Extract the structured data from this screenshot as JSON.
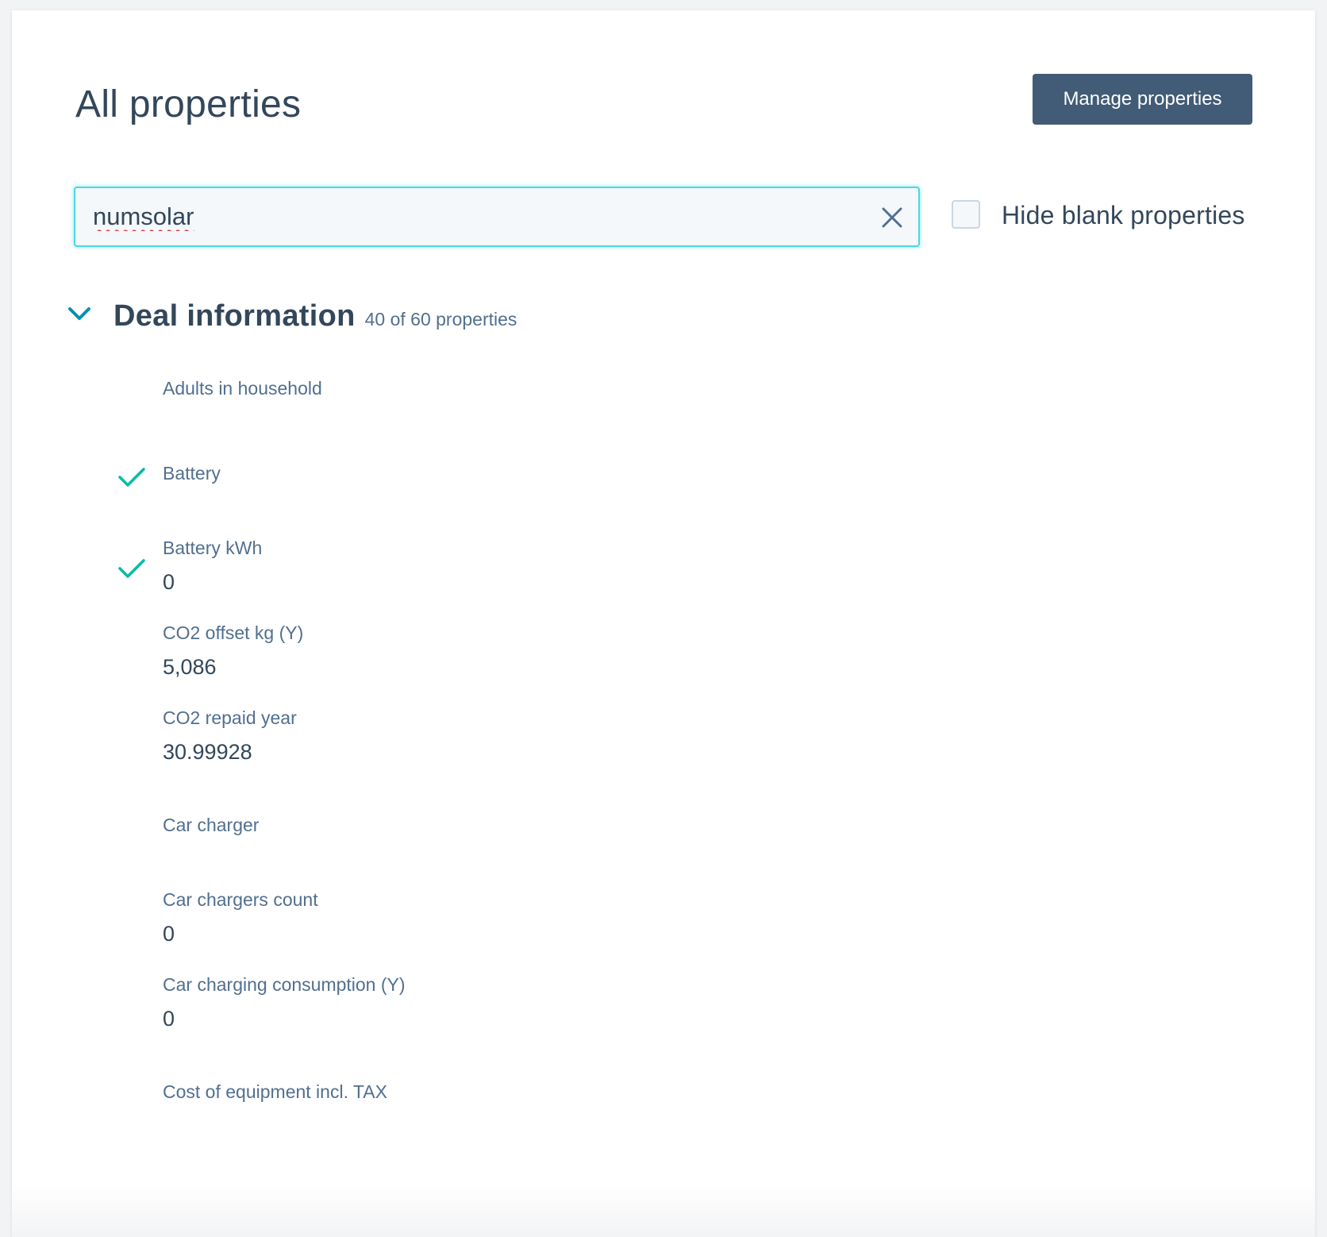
{
  "header": {
    "title": "All properties",
    "manage_button_label": "Manage properties"
  },
  "search": {
    "value": "numsolar",
    "clear_icon": "close-icon"
  },
  "filters": {
    "hide_blank_label": "Hide blank properties",
    "hide_blank_checked": false
  },
  "section": {
    "title": "Deal information",
    "count": "40 of 60 properties",
    "expanded": true
  },
  "properties": [
    {
      "label": "Adults in household",
      "value": "",
      "synced": false
    },
    {
      "label": "Battery",
      "value": "",
      "synced": true
    },
    {
      "label": "Battery kWh",
      "value": "0",
      "synced": true
    },
    {
      "label": "CO2 offset kg (Y)",
      "value": "5,086",
      "synced": false
    },
    {
      "label": "CO2 repaid year",
      "value": "30.99928",
      "synced": false
    },
    {
      "label": "Car charger",
      "value": "",
      "synced": false
    },
    {
      "label": "Car chargers count",
      "value": "0",
      "synced": false
    },
    {
      "label": "Car charging consumption (Y)",
      "value": "0",
      "synced": false
    },
    {
      "label": "Cost of equipment incl. TAX",
      "value": "",
      "synced": false
    }
  ],
  "colors": {
    "accent": "#00bda5",
    "button_bg": "#425b76",
    "focus_border": "#4cd6e8",
    "chevron": "#0091ae",
    "text_primary": "#33475b",
    "text_secondary": "#516f90"
  }
}
